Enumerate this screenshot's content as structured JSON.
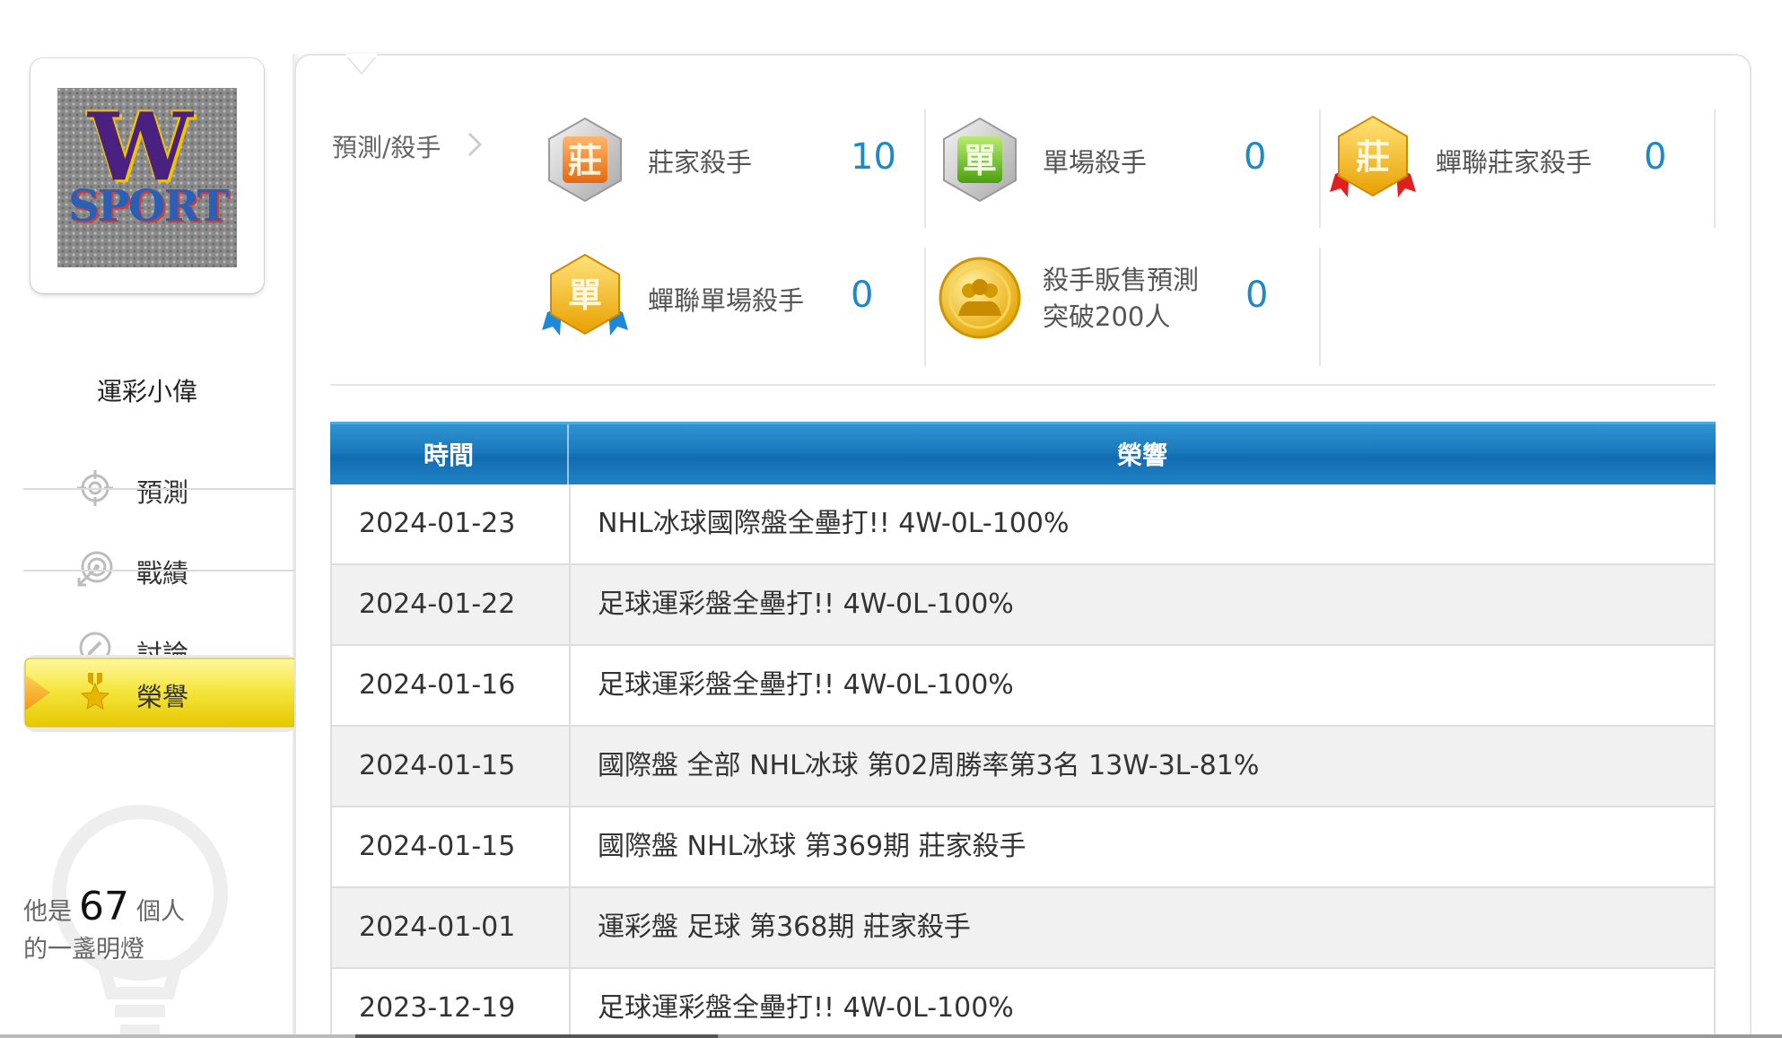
{
  "profile": {
    "username": "運彩小偉",
    "avatar_text_top": "W",
    "avatar_text_bottom": "SPORT"
  },
  "nav": {
    "items": [
      {
        "label": "預測",
        "icon": "crosshair-icon"
      },
      {
        "label": "戰績",
        "icon": "target-arrow-icon"
      },
      {
        "label": "討論",
        "icon": "chat-pencil-icon"
      },
      {
        "label": "榮譽",
        "icon": "award-star-icon",
        "active": true
      }
    ]
  },
  "fans": {
    "prefix": "他是",
    "count": "67",
    "suffix": "個人",
    "line2": "的一盞明燈"
  },
  "stats_header": {
    "label": "預測/殺手"
  },
  "stats": [
    {
      "label": "莊家殺手",
      "value": "10",
      "badge_char": "莊",
      "badge": "silver-zhuang-badge-icon"
    },
    {
      "label": "單場殺手",
      "value": "0",
      "badge_char": "單",
      "badge": "silver-dan-badge-icon"
    },
    {
      "label": "蟬聯莊家殺手",
      "value": "0",
      "badge_char": "莊",
      "badge": "gold-zhuang-ribbon-badge-icon"
    },
    {
      "label": "蟬聯單場殺手",
      "value": "0",
      "badge_char": "單",
      "badge": "gold-dan-ribbon-badge-icon"
    },
    {
      "label": "殺手販售預測突破200人",
      "value": "0",
      "badge": "gold-people-coin-icon"
    }
  ],
  "table": {
    "headers": {
      "time": "時間",
      "honor": "榮響"
    },
    "rows": [
      {
        "date": "2024-01-23",
        "honor": "NHL冰球國際盤全壘打!! 4W-0L-100%"
      },
      {
        "date": "2024-01-22",
        "honor": "足球運彩盤全壘打!! 4W-0L-100%"
      },
      {
        "date": "2024-01-16",
        "honor": "足球運彩盤全壘打!! 4W-0L-100%"
      },
      {
        "date": "2024-01-15",
        "honor": "國際盤 全部 NHL冰球 第02周勝率第3名 13W-3L-81%"
      },
      {
        "date": "2024-01-15",
        "honor": "國際盤 NHL冰球 第369期 莊家殺手"
      },
      {
        "date": "2024-01-01",
        "honor": "運彩盤 足球 第368期 莊家殺手"
      },
      {
        "date": "2023-12-19",
        "honor": "足球運彩盤全壘打!! 4W-0L-100%"
      }
    ]
  },
  "colors": {
    "accent_blue": "#1e88c8",
    "header_blue": "#1a79bd",
    "active_yellow": "#f5e64a",
    "gold": "#f2b200"
  }
}
